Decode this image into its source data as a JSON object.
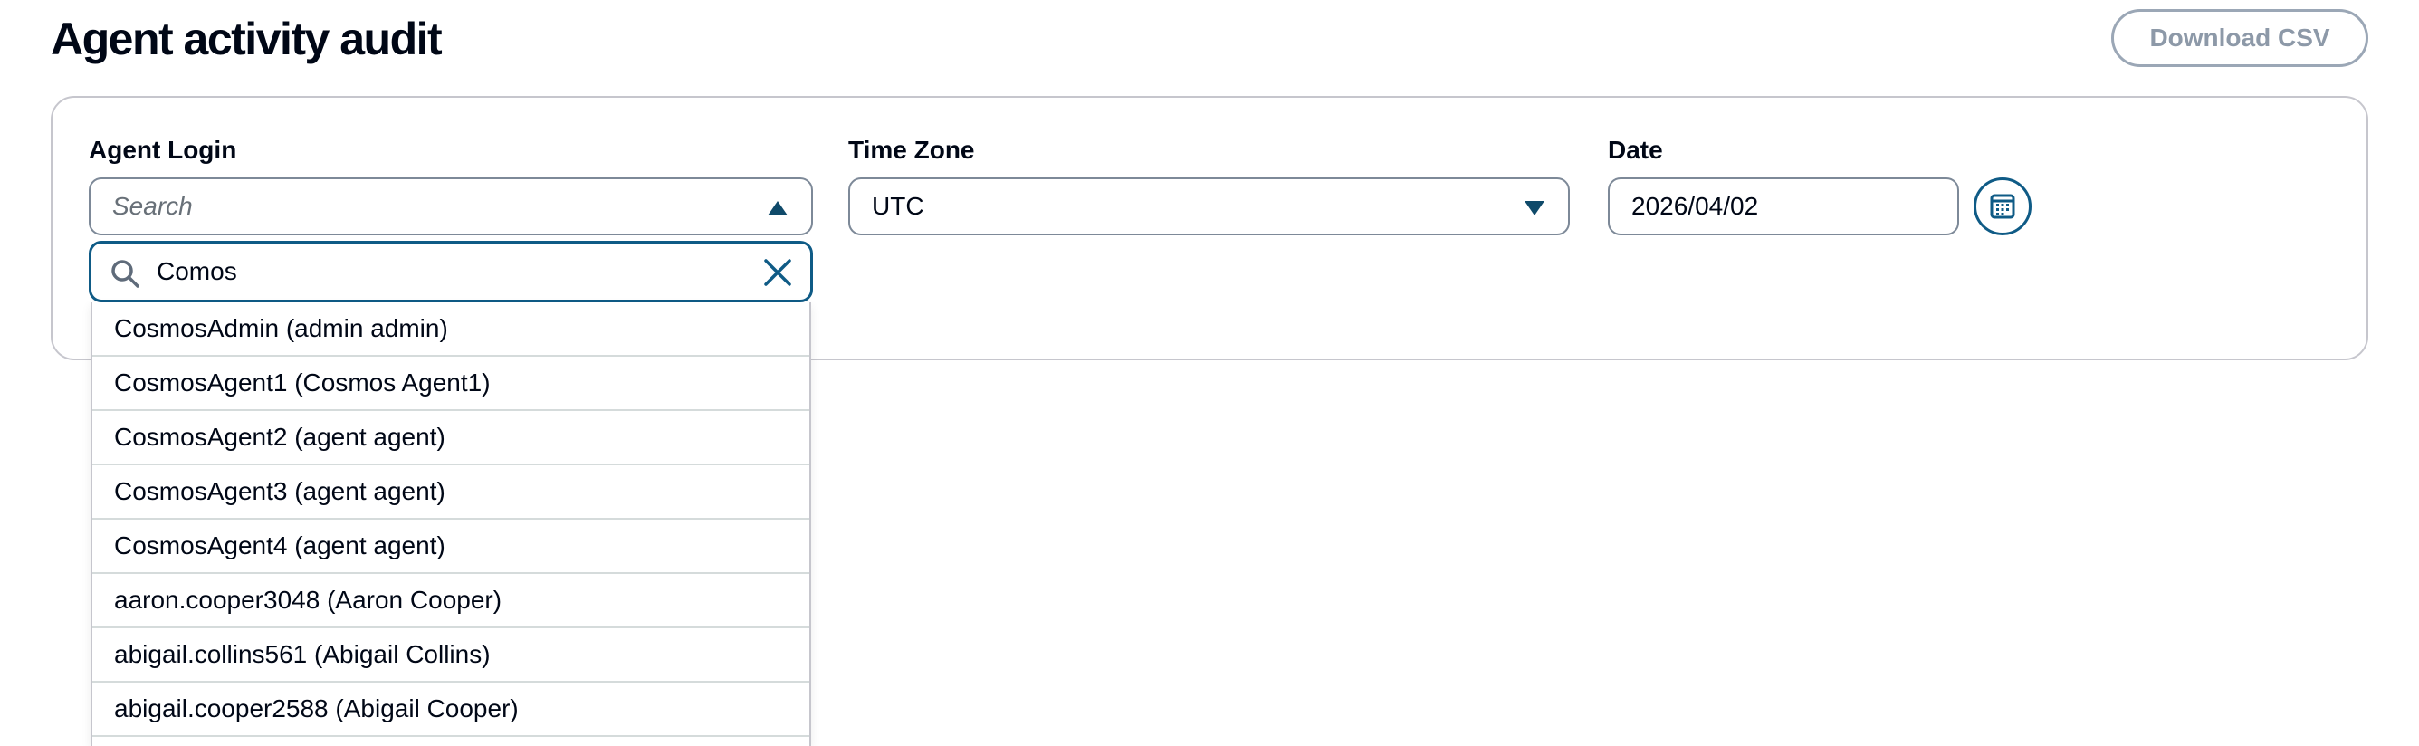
{
  "page": {
    "title": "Agent activity audit"
  },
  "toolbar": {
    "download_label": "Download CSV"
  },
  "filters": {
    "agent_login": {
      "label": "Agent Login",
      "placeholder": "Search",
      "search_value": "Comos",
      "options": [
        "CosmosAdmin (admin admin)",
        "CosmosAgent1 (Cosmos Agent1)",
        "CosmosAgent2 (agent agent)",
        "CosmosAgent3 (agent agent)",
        "CosmosAgent4 (agent agent)",
        "aaron.cooper3048 (Aaron Cooper)",
        "abigail.collins561 (Abigail Collins)",
        "abigail.cooper2588 (Abigail Cooper)"
      ]
    },
    "time_zone": {
      "label": "Time Zone",
      "value": "UTC"
    },
    "date": {
      "label": "Date",
      "value": "2026/04/02"
    }
  },
  "icons": {
    "caret_up": "caret-up-icon",
    "caret_down": "caret-down-icon",
    "calendar": "calendar-icon",
    "search": "search-icon",
    "clear": "close-icon"
  },
  "colors": {
    "accent": "#0f5b86",
    "caret": "#0f4a6a",
    "border": "#7d8998",
    "disabled": "#8d99a8"
  }
}
